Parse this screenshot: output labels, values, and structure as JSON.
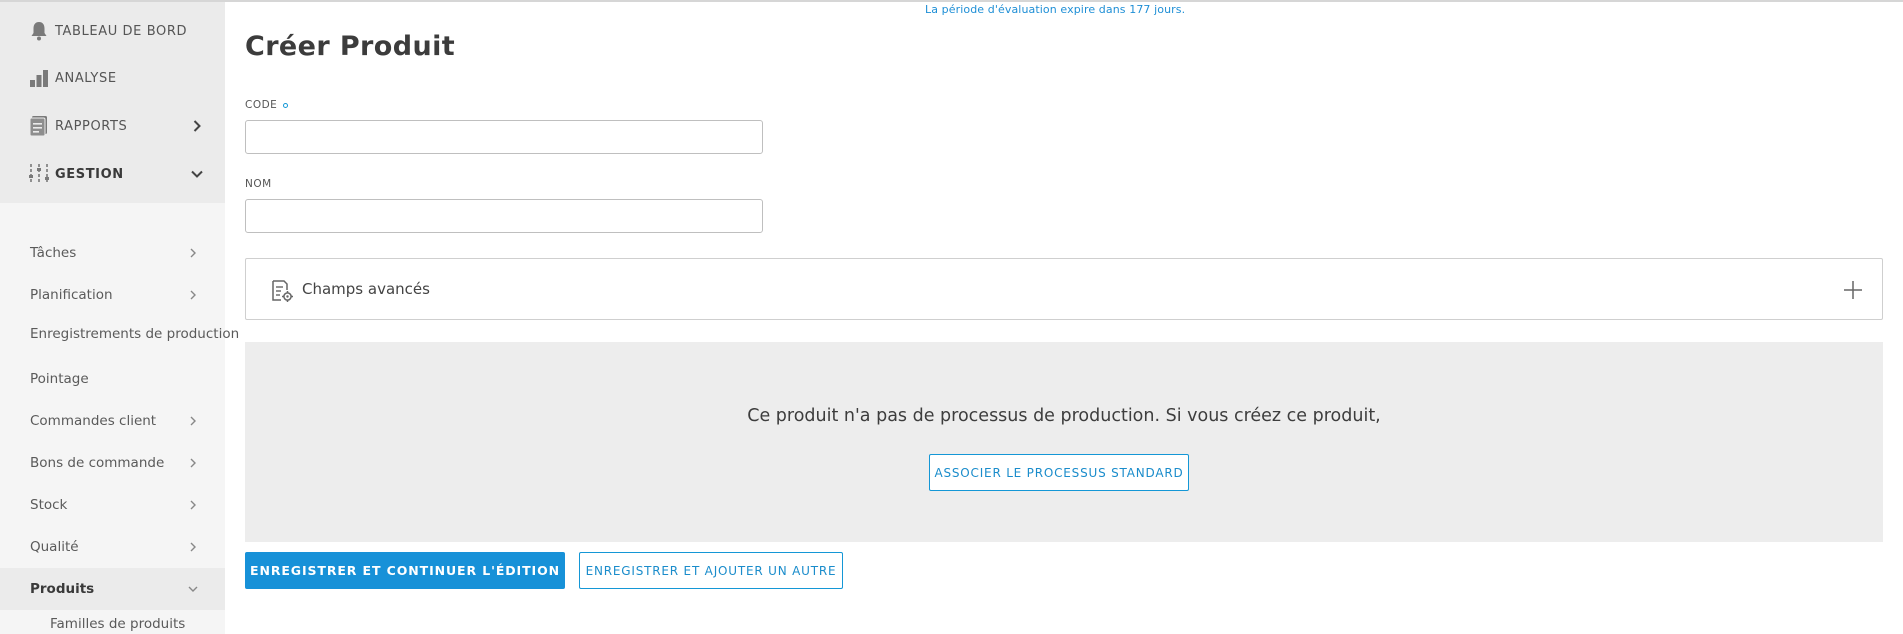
{
  "banner": {
    "text": "La période d'évaluation expire dans 177 jours."
  },
  "sidebar": {
    "top_items": [
      {
        "label": "TABLEAU DE BORD",
        "icon": "bell-icon"
      },
      {
        "label": "ANALYSE",
        "icon": "bar-chart-icon"
      },
      {
        "label": "RAPPORTS",
        "icon": "reports-icon"
      },
      {
        "label": "GESTION",
        "icon": "sliders-icon"
      }
    ],
    "sub_items": [
      {
        "label": "Tâches"
      },
      {
        "label": "Planification"
      },
      {
        "label": "Enregistrements de production"
      },
      {
        "label": "Pointage"
      },
      {
        "label": "Commandes client"
      },
      {
        "label": "Bons de commande"
      },
      {
        "label": "Stock"
      },
      {
        "label": "Qualité"
      },
      {
        "label": "Produits"
      }
    ],
    "sub_sub_items": [
      {
        "label": "Familles de produits"
      }
    ]
  },
  "page": {
    "title": "Créer Produit",
    "code_label": "CODE",
    "name_label": "NOM",
    "code_value": "",
    "name_value": ""
  },
  "advanced": {
    "label": "Champs avancés"
  },
  "process": {
    "message": "Ce produit n'a pas de processus de production. Si vous créez ce produit,",
    "associate_button": "ASSOCIER LE PROCESSUS STANDARD"
  },
  "actions": {
    "save_continue": "ENREGISTRER ET CONTINUER L'ÉDITION",
    "save_add": "ENREGISTRER ET AJOUTER UN AUTRE"
  },
  "colors": {
    "accent": "#1791d8",
    "sidebar_bg": "#f5f5f5",
    "process_bg": "#ededed"
  }
}
